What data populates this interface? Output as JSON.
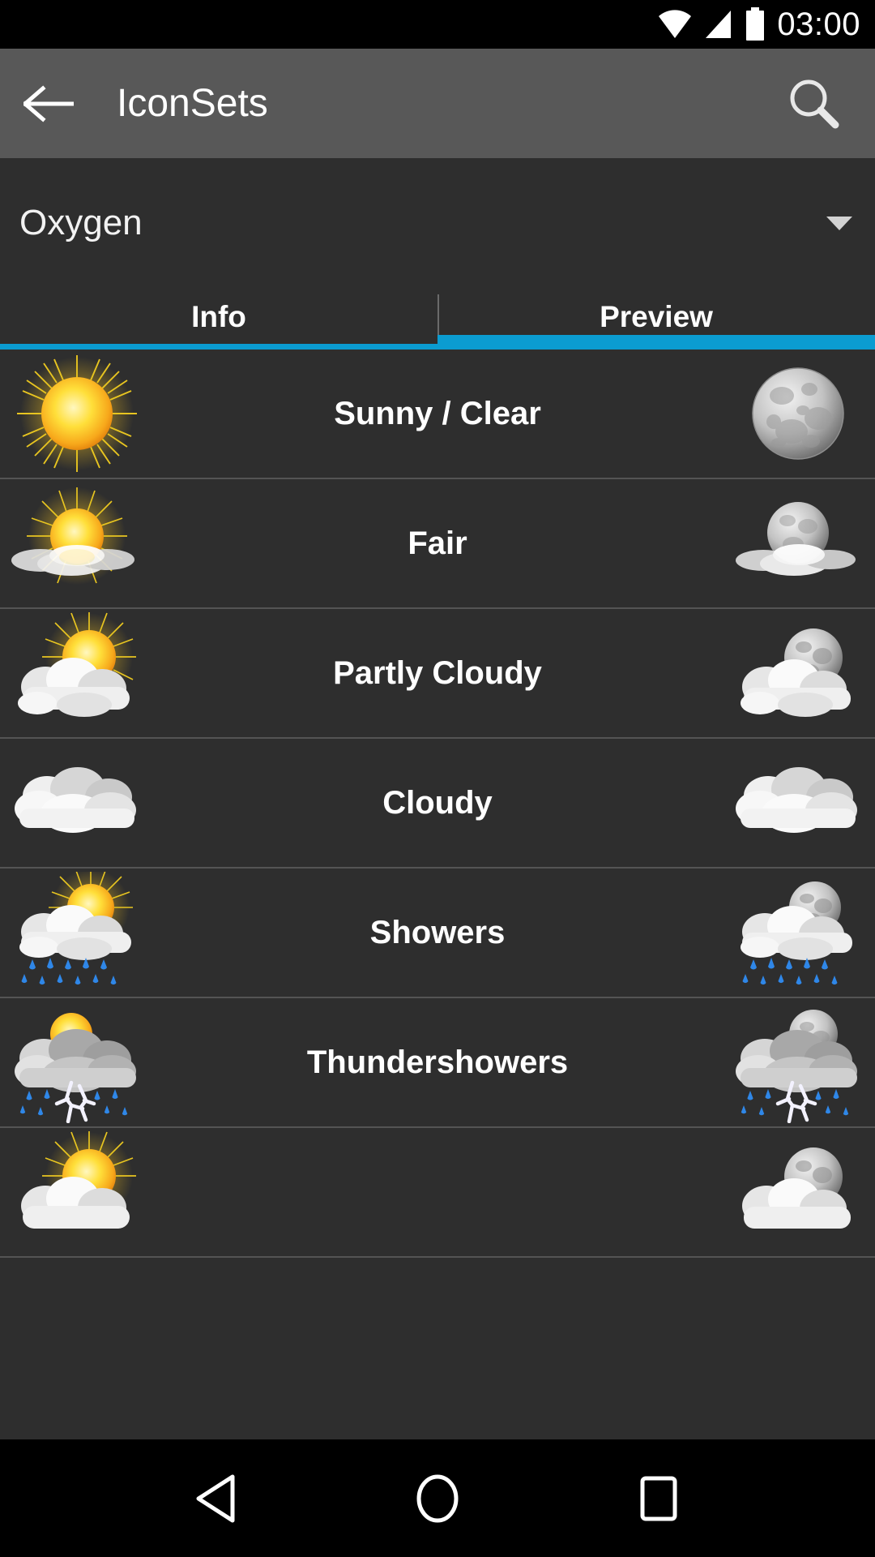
{
  "status_bar": {
    "time": "03:00",
    "icons": [
      "wifi-icon",
      "signal-icon",
      "battery-icon"
    ]
  },
  "app_bar": {
    "back_icon": "back-arrow-icon",
    "title": "IconSets",
    "search_icon": "search-icon"
  },
  "spinner": {
    "label": "Oxygen",
    "caret_icon": "chevron-down-icon"
  },
  "tabs": [
    {
      "label": "Info",
      "active": false
    },
    {
      "label": "Preview",
      "active": true
    }
  ],
  "colors": {
    "accent": "#0b9cd1",
    "app_bar": "#585858",
    "background": "#2e2e2e",
    "divider": "#545454",
    "status_bar": "#000000",
    "text": "#ffffff"
  },
  "rows": [
    {
      "label": "Sunny / Clear",
      "day_icon": "sun-icon",
      "night_icon": "moon-icon"
    },
    {
      "label": "Fair",
      "day_icon": "sun-haze-icon",
      "night_icon": "moon-haze-icon"
    },
    {
      "label": "Partly Cloudy",
      "day_icon": "sun-cloud-icon",
      "night_icon": "moon-cloud-icon"
    },
    {
      "label": "Cloudy",
      "day_icon": "cloud-icon",
      "night_icon": "cloud-icon"
    },
    {
      "label": "Showers",
      "day_icon": "sun-cloud-rain-icon",
      "night_icon": "moon-cloud-rain-icon"
    },
    {
      "label": "Thundershowers",
      "day_icon": "sun-cloud-thunderstorm-icon",
      "night_icon": "moon-cloud-thunderstorm-icon"
    },
    {
      "label": "",
      "day_icon": "sun-cloud-icon",
      "night_icon": "moon-cloud-icon"
    }
  ],
  "nav_bar": {
    "back_icon": "nav-back-triangle-icon",
    "home_icon": "nav-home-circle-icon",
    "recents_icon": "nav-recents-square-icon"
  }
}
